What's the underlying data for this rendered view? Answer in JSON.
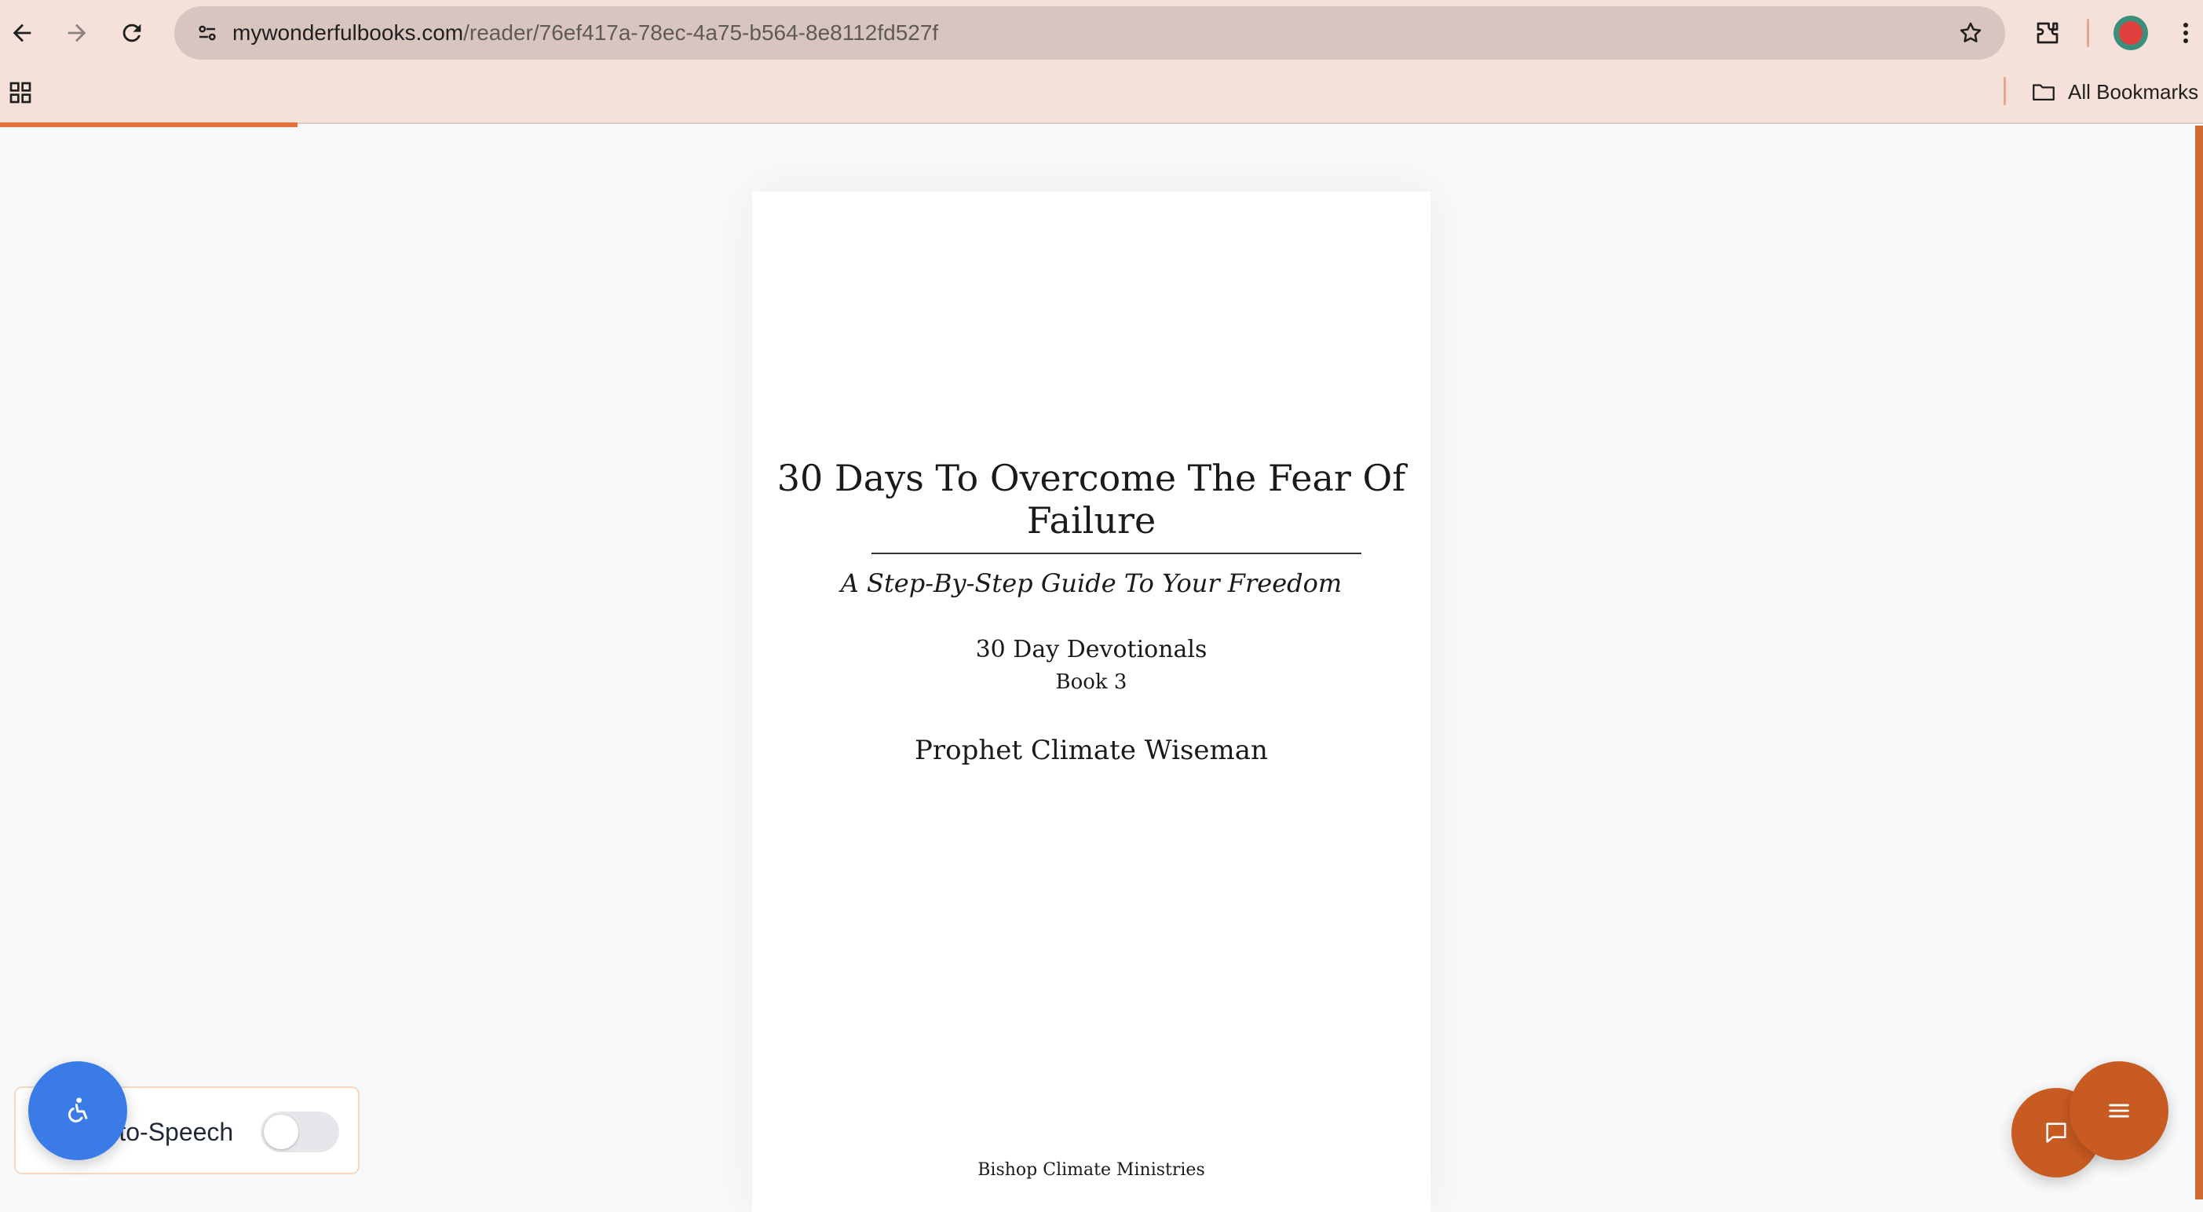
{
  "browser": {
    "url_host": "mywonderfulbooks.com",
    "url_path": "/reader/76ef417a-78ec-4a75-b564-8e8112fd527f",
    "bookmarks_label": "All Bookmarks"
  },
  "reader": {
    "progress_fraction": 0.135
  },
  "book": {
    "title": "30 Days To Overcome The Fear Of Failure",
    "subtitle": "A Step-By-Step Guide To Your Freedom",
    "series": "30 Day Devotionals",
    "book_number": "Book 3",
    "author": "Prophet Climate Wiseman",
    "publisher": "Bishop Climate Ministries"
  },
  "widgets": {
    "tts_label": "Text-to-Speech",
    "tts_enabled": false
  },
  "colors": {
    "chrome_bg": "#f5e1da",
    "accent_orange": "#c85b22",
    "accessibility_blue": "#3b7be8"
  }
}
